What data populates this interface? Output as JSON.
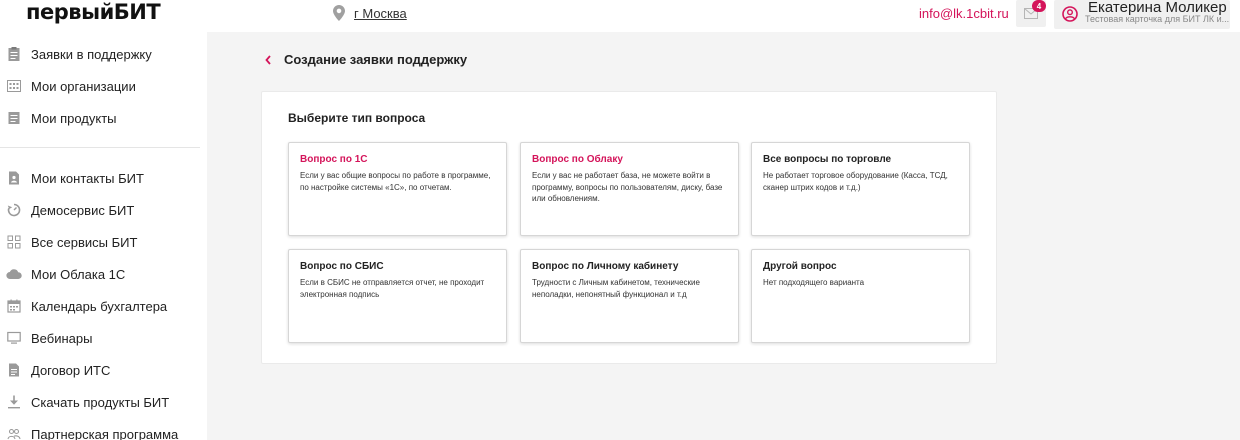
{
  "header": {
    "logo": {
      "part1": "первый",
      "part2": "БИТ"
    },
    "location": {
      "city": "г Москва"
    },
    "email": "info@lk.1cbit.ru",
    "notifications": {
      "count": "4"
    },
    "user": {
      "name": "Екатерина Моликер",
      "subtitle": "Тестовая карточка для БИТ ЛК и..."
    }
  },
  "sidebar": {
    "items": [
      {
        "label": "Заявки в поддержку",
        "icon": "clipboard-icon"
      },
      {
        "label": "Мои организации",
        "icon": "building-icon"
      },
      {
        "label": "Мои продукты",
        "icon": "document-icon"
      },
      {
        "label": "Мои контакты БИТ",
        "icon": "contact-card-icon"
      },
      {
        "label": "Демосервис БИТ",
        "icon": "refresh-icon"
      },
      {
        "label": "Все сервисы БИТ",
        "icon": "grid-icon"
      },
      {
        "label": "Мои Облака 1С",
        "icon": "cloud-icon"
      },
      {
        "label": "Календарь бухгалтера",
        "icon": "calendar-icon"
      },
      {
        "label": "Вебинары",
        "icon": "monitor-icon"
      },
      {
        "label": "Договор ИТС",
        "icon": "file-icon"
      },
      {
        "label": "Скачать продукты БИТ",
        "icon": "download-icon"
      },
      {
        "label": "Партнерская программа",
        "icon": "people-icon"
      }
    ]
  },
  "main": {
    "title": "Создание заявки поддержку",
    "panel_title": "Выберите тип вопроса",
    "cards": [
      {
        "title": "Вопрос по 1С",
        "desc": "Если у вас общие вопросы по работе в программе, по настройке системы «1С», по отчетам.",
        "accent": true
      },
      {
        "title": "Вопрос по Облаку",
        "desc": "Если у вас не работает база, не можете войти в программу, вопросы по пользователям, диску, базе или обновлениям.",
        "accent": true
      },
      {
        "title": "Все вопросы по торговле",
        "desc": "Не работает торговое оборудование (Касса, ТСД, сканер штрих кодов и т.д.)",
        "accent": false
      },
      {
        "title": "Вопрос по СБИС",
        "desc": "Если в СБИС не отправляется отчет, не проходит электронная подпись",
        "accent": false
      },
      {
        "title": "Вопрос по Личному кабинету",
        "desc": "Трудности с Личным кабинетом, технические неполадки, непонятный функционал и т.д",
        "accent": false
      },
      {
        "title": "Другой вопрос",
        "desc": "Нет подходящего варианта",
        "accent": false
      }
    ]
  },
  "colors": {
    "accent": "#d4145a",
    "icon_gray": "#9a9a9a"
  }
}
